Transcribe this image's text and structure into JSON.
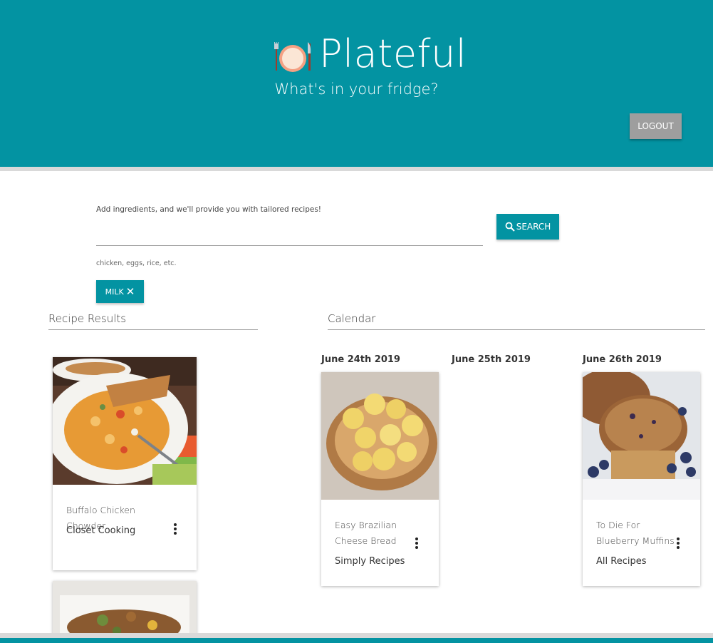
{
  "header": {
    "brand": "Plateful",
    "tagline": "What's in your fridge?",
    "logout_label": "LOGOUT",
    "logo_icon": "plate-icon",
    "accent": "#0393a2"
  },
  "search": {
    "prompt": "Add ingredients, and we'll provide you with tailored recipes!",
    "value": "",
    "hint": "chicken, eggs, rice, etc.",
    "button_label": "SEARCH",
    "button_icon": "search-icon",
    "chips": [
      {
        "label": "MILK",
        "icon": "close-icon"
      }
    ]
  },
  "recipes": {
    "title": "Recipe Results",
    "items": [
      {
        "title": "Buffalo Chicken Chowder",
        "source": "Closet Cooking",
        "image": "buffalo-chicken-chowder"
      },
      {
        "title": "",
        "source": "",
        "image": "roasted-chicken-dish"
      }
    ]
  },
  "calendar": {
    "title": "Calendar",
    "days": [
      {
        "date": "June 24th 2019",
        "recipe": {
          "title": "Easy Brazilian Cheese Bread",
          "source": "Simply Recipes",
          "image": "cheese-bread"
        }
      },
      {
        "date": "June 25th 2019",
        "recipe": null
      },
      {
        "date": "June 26th 2019",
        "recipe": {
          "title": "To Die For Blueberry Muffins",
          "source": "All Recipes",
          "image": "blueberry-muffins"
        }
      }
    ]
  }
}
